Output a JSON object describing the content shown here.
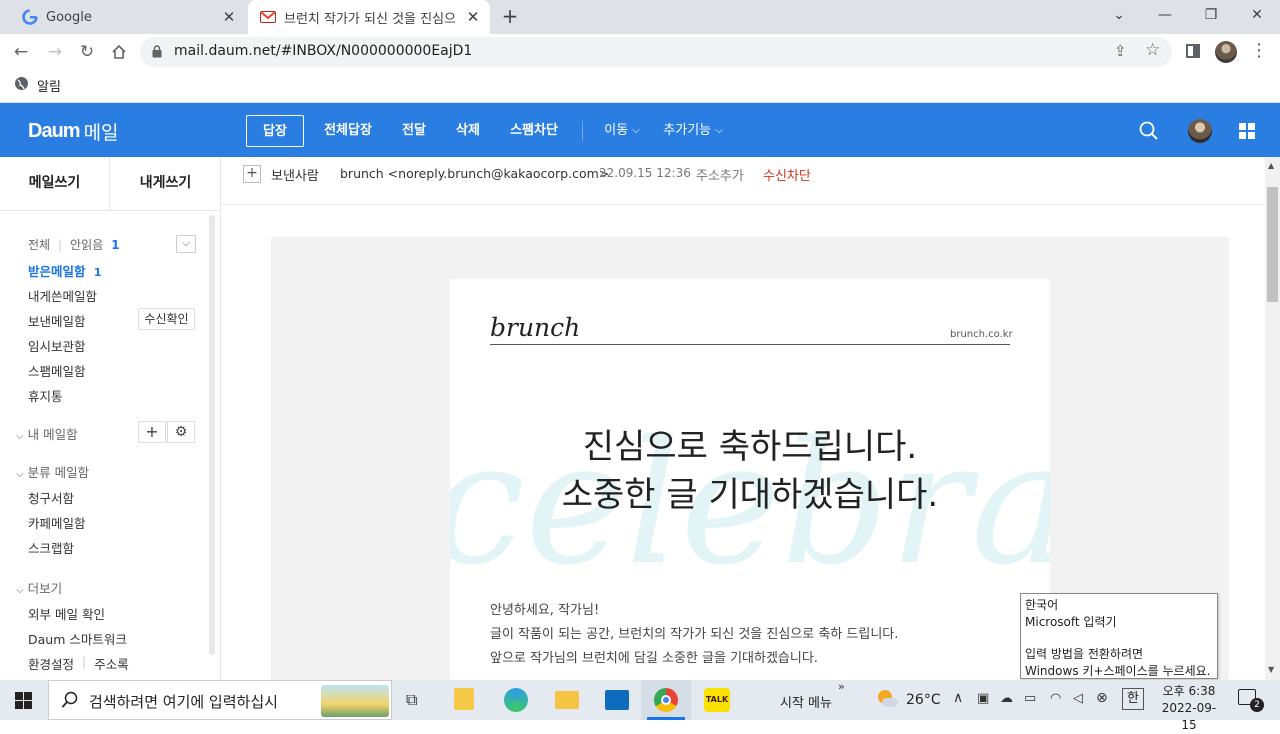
{
  "browser": {
    "tabs": [
      {
        "title": "Google"
      },
      {
        "title": "브런치 작가가 되신 것을 진심으"
      }
    ],
    "url": "mail.daum.net/#INBOX/N000000000EajD1",
    "bookmark": "알림"
  },
  "daum": {
    "logo": "Daum",
    "logo_suffix": "메일",
    "actions": [
      "답장",
      "전체답장",
      "전달",
      "삭제",
      "스팸차단"
    ],
    "menus": [
      "이동",
      "추가기능"
    ]
  },
  "sidebar": {
    "compose": "메일쓰기",
    "self_compose": "내게쓰기",
    "filter_all": "전체",
    "filter_unread": "안읽음",
    "unread_count": "1",
    "folders": [
      {
        "label": "받은메일함",
        "count": "1"
      },
      {
        "label": "내게쓴메일함"
      },
      {
        "label": "보낸메일함",
        "badge": "수신확인"
      },
      {
        "label": "임시보관함"
      },
      {
        "label": "스팸메일함"
      },
      {
        "label": "휴지통"
      }
    ],
    "my_mailbox": "내 메일함",
    "category": "분류 메일함",
    "categories": [
      "청구서함",
      "카페메일함",
      "스크랩함"
    ],
    "more": "더보기",
    "more_items": [
      "외부 메일 확인",
      "Daum 스마트워크"
    ],
    "settings": "환경설정",
    "address_book": "주소록"
  },
  "mail": {
    "sender_label": "보낸사람",
    "sender": "brunch <noreply.brunch@kakaocorp.com>",
    "date": "22.09.15 12:36",
    "add_address": "주소추가",
    "block": "수신차단",
    "brand": "brunch",
    "brand_url": "brunch.co.kr",
    "headline1": "진심으로 축하드립니다.",
    "headline2": "소중한 글 기대하겠습니다.",
    "watermark": "celebrate",
    "body": [
      "안녕하세요, 작가님!",
      "글이 작품이 되는 공간, 브런치의 작가가 되신 것을 진심으로 축하 드립니다.",
      "앞으로 작가님의 브런치에 담길 소중한 글을 기대하겠습니다."
    ]
  },
  "ime_tooltip": {
    "line1": "한국어",
    "line2": "Microsoft 입력기",
    "line3": "입력 방법을 전환하려면",
    "line4": "Windows 키+스페이스를 누르세요."
  },
  "taskbar": {
    "search": "검색하려면 여기에 입력하십시",
    "start_menu": "시작 메뉴",
    "temperature": "26°C",
    "ime": "한",
    "time": "오후 6:38",
    "date": "2022-09-15",
    "notifications": "2",
    "talk": "TALK"
  },
  "colors": {
    "daum_blue": "#2a7de1",
    "accent_blue": "#1a73e8",
    "block_red": "#d2341c"
  }
}
